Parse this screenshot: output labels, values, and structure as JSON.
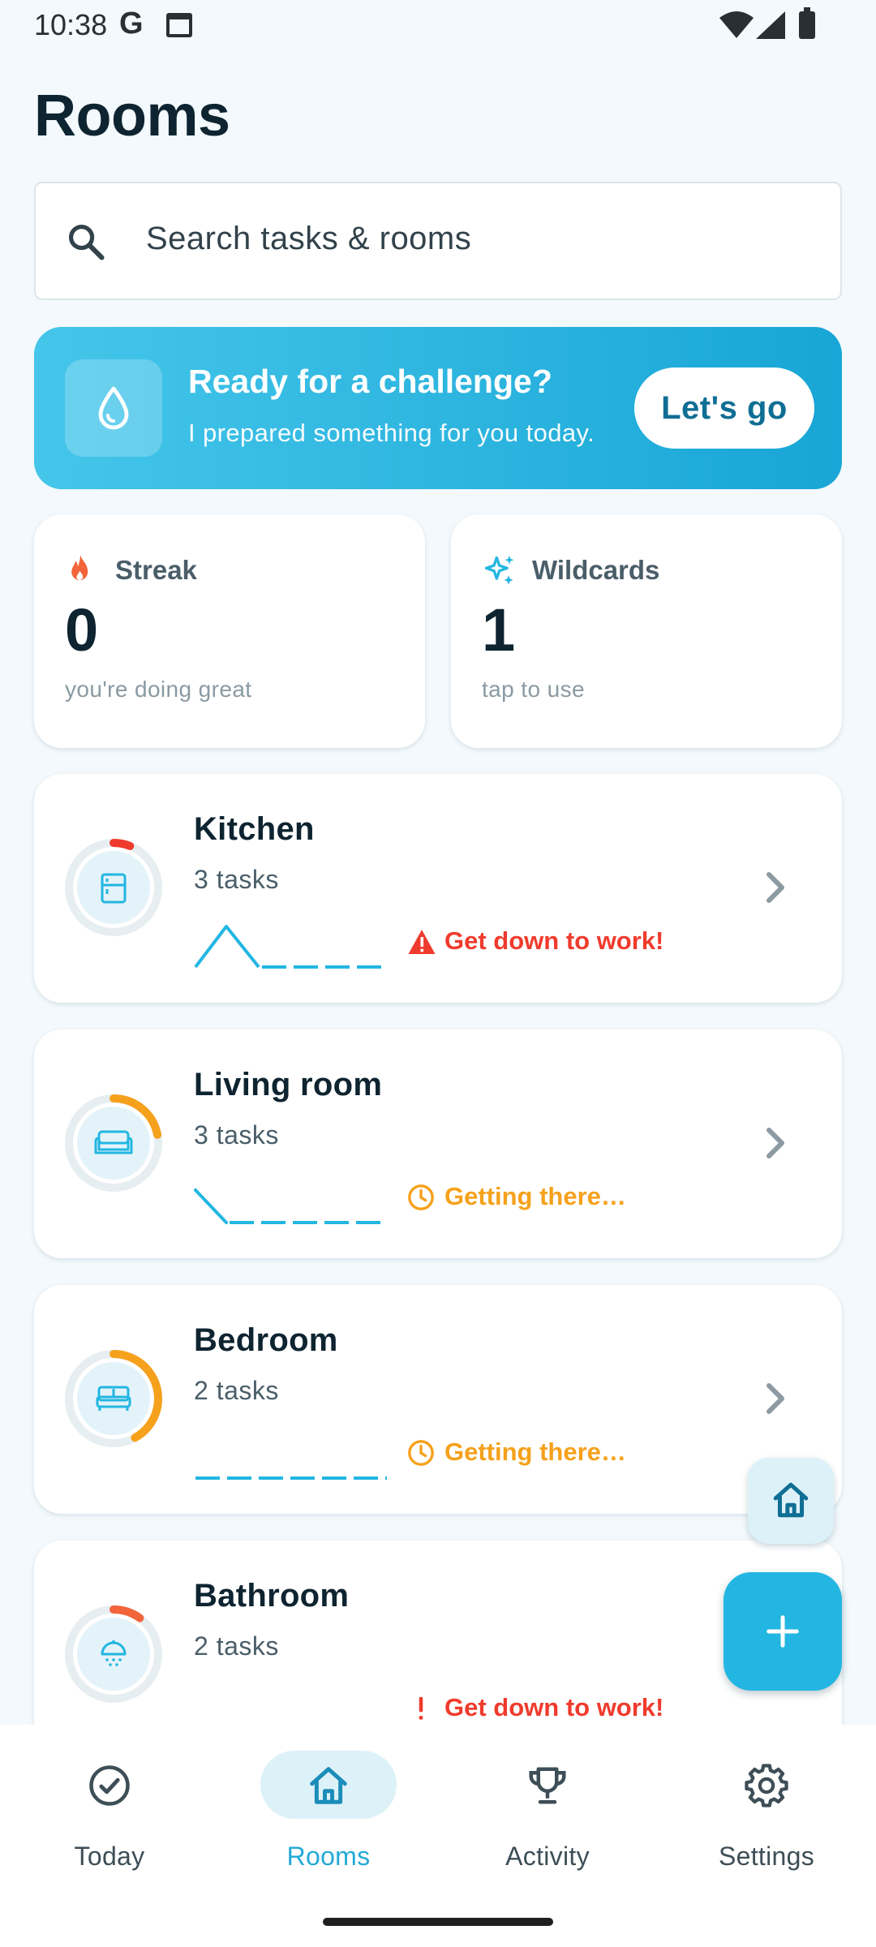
{
  "status_bar": {
    "time": "10:38",
    "google_letter": "G",
    "icons": [
      "google-icon",
      "calendar-icon",
      "wifi-icon",
      "signal-icon",
      "battery-icon"
    ]
  },
  "header": {
    "title": "Rooms"
  },
  "search": {
    "placeholder": "Search tasks & rooms",
    "icon": "search-icon"
  },
  "challenge": {
    "title": "Ready for a challenge?",
    "subtitle": "I prepared something for you today.",
    "button_label": "Let's go",
    "icon": "water-drop-icon"
  },
  "stats": {
    "streak": {
      "label": "Streak",
      "value": "0",
      "note": "you're doing great",
      "icon": "fire-icon",
      "color": "#F2643A"
    },
    "wildcards": {
      "label": "Wildcards",
      "value": "1",
      "note": "tap to use",
      "icon": "sparkles-icon",
      "color": "#23B6E2"
    }
  },
  "rooms": [
    {
      "name": "Kitchen",
      "tasks": "3 tasks",
      "status": "Get down to work!",
      "status_level": "urgent",
      "status_icon": "warning-triangle-icon",
      "progress": 0.06,
      "ring_color": "#EF3B2D",
      "icon": "fridge-icon"
    },
    {
      "name": "Living room",
      "tasks": "3 tasks",
      "status": "Getting there…",
      "status_level": "progress",
      "status_icon": "clock-icon",
      "progress": 0.22,
      "ring_color": "#F5A11C",
      "icon": "sofa-icon"
    },
    {
      "name": "Bedroom",
      "tasks": "2 tasks",
      "status": "Getting there…",
      "status_level": "progress",
      "status_icon": "clock-icon",
      "progress": 0.42,
      "ring_color": "#F5A11C",
      "icon": "bed-icon"
    },
    {
      "name": "Bathroom",
      "tasks": "2 tasks",
      "status": "Get down to work!",
      "status_level": "urgent",
      "status_icon": "exclamation-icon",
      "progress": 0.1,
      "ring_color": "#F2643A",
      "icon": "shower-icon"
    }
  ],
  "fabs": {
    "home": "home-icon",
    "add": "plus-icon"
  },
  "nav": [
    {
      "label": "Today",
      "icon": "check-circle-icon",
      "active": false
    },
    {
      "label": "Rooms",
      "icon": "home-icon",
      "active": true
    },
    {
      "label": "Activity",
      "icon": "trophy-icon",
      "active": false
    },
    {
      "label": "Settings",
      "icon": "gear-icon",
      "active": false
    }
  ],
  "colors": {
    "background": "#F3F9FC",
    "accent": "#23B6E2",
    "text_primary": "#0E2430",
    "urgent": "#EF3B2D",
    "progress": "#F5A11C"
  }
}
